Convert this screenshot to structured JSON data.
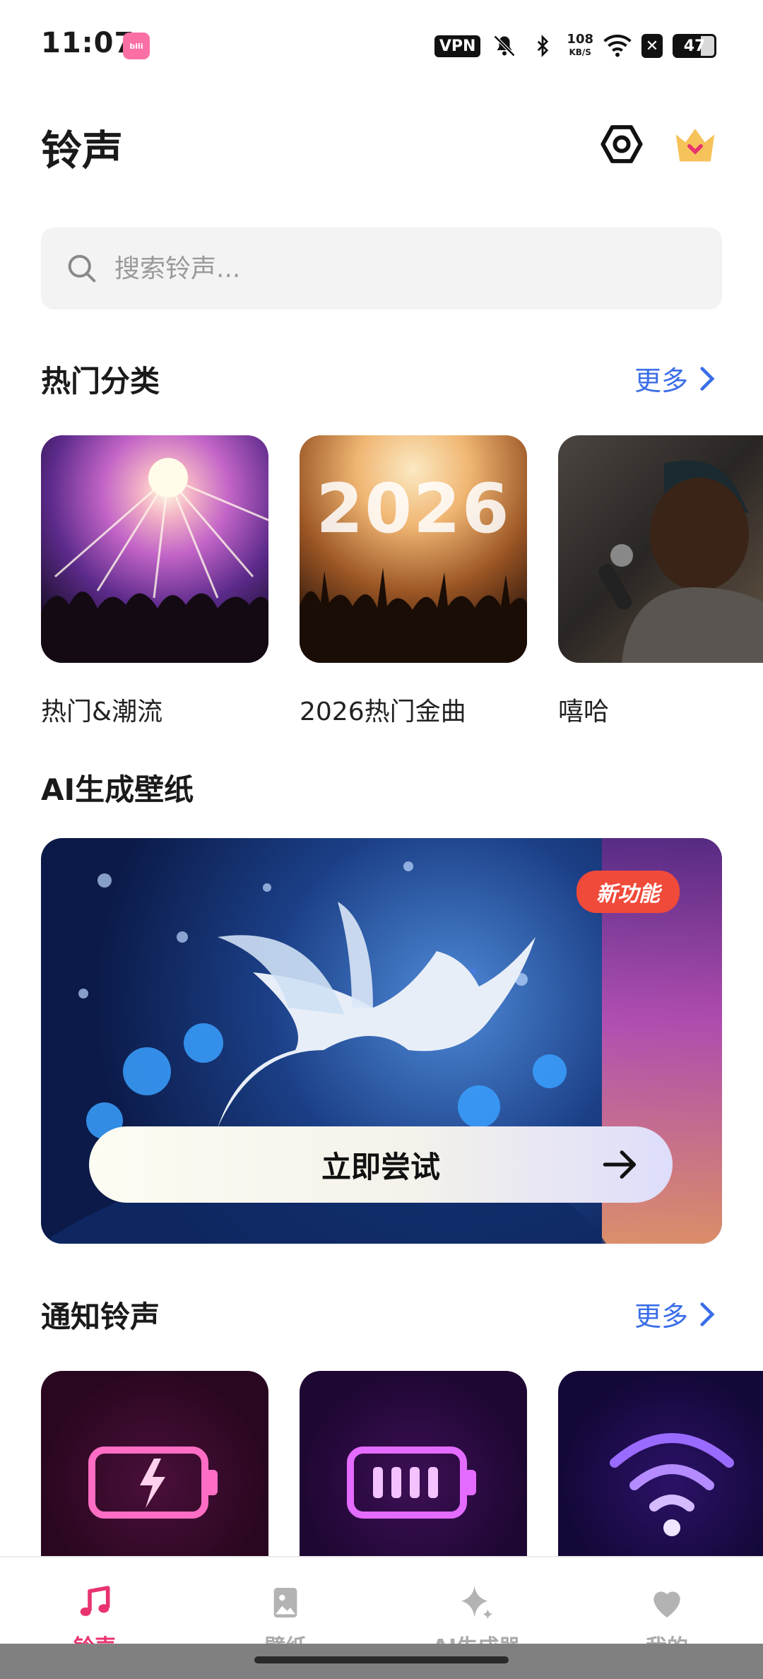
{
  "status_bar": {
    "time": "11:07",
    "app_badge": "bilibili",
    "vpn": "VPN",
    "net_speed_value": "108",
    "net_speed_unit": "KB/S",
    "battery": "47",
    "icons": [
      "mute-icon",
      "bluetooth-icon",
      "wifi-icon",
      "close-box-icon",
      "battery-icon"
    ]
  },
  "header": {
    "title": "铃声",
    "icons": [
      "settings-icon",
      "crown-icon"
    ]
  },
  "search": {
    "placeholder": "搜索铃声..."
  },
  "hot_categories": {
    "title": "热门分类",
    "more": "更多",
    "items": [
      {
        "label": "热门&潮流"
      },
      {
        "label": "2026热门金曲",
        "image_text": "2026"
      },
      {
        "label": "嘻哈"
      }
    ]
  },
  "ai_wallpaper": {
    "title": "AI生成壁纸",
    "badge": "新功能",
    "cta": "立即尝试"
  },
  "notification_ringtones": {
    "title": "通知铃声",
    "more": "更多",
    "items": [
      {
        "icon": "battery-charging-icon"
      },
      {
        "icon": "battery-full-icon"
      },
      {
        "icon": "wifi-neon-icon"
      }
    ]
  },
  "bottom_nav": {
    "items": [
      {
        "label": "铃声",
        "icon": "music-note-icon",
        "active": true
      },
      {
        "label": "壁纸",
        "icon": "image-icon",
        "active": false
      },
      {
        "label": "AI生成器",
        "icon": "sparkle-icon",
        "active": false
      },
      {
        "label": "我的",
        "icon": "heart-icon",
        "active": false
      }
    ]
  },
  "colors": {
    "accent": "#e8336e",
    "link": "#3a6ee8",
    "badge": "#f04a3a"
  }
}
